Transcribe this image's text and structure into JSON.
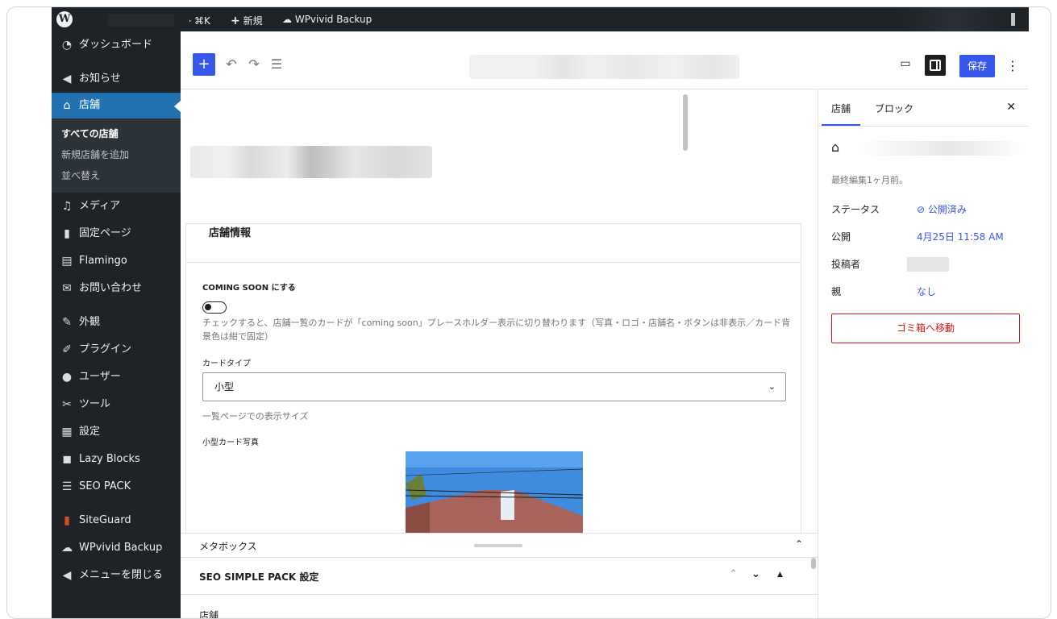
{
  "adminbar": {
    "wp_logo": "W",
    "shortcut": "⌘K",
    "new_label": "新規",
    "backup_label": "WPvivid Backup"
  },
  "sidebar": {
    "items": [
      {
        "label": "ダッシュボード",
        "icon": "dashboard-icon"
      },
      {
        "label": "お知らせ",
        "icon": "megaphone-icon"
      },
      {
        "label": "店舗",
        "icon": "store-icon"
      },
      {
        "label": "メディア",
        "icon": "media-icon"
      },
      {
        "label": "固定ページ",
        "icon": "page-icon"
      },
      {
        "label": "Flamingo",
        "icon": "flamingo-icon"
      },
      {
        "label": "お問い合わせ",
        "icon": "mail-icon"
      },
      {
        "label": "外観",
        "icon": "brush-icon"
      },
      {
        "label": "プラグイン",
        "icon": "plugin-icon"
      },
      {
        "label": "ユーザー",
        "icon": "user-icon"
      },
      {
        "label": "ツール",
        "icon": "wrench-icon"
      },
      {
        "label": "設定",
        "icon": "settings-icon"
      },
      {
        "label": "Lazy Blocks",
        "icon": "lazyblocks-icon"
      },
      {
        "label": "SEO PACK",
        "icon": "seo-icon"
      },
      {
        "label": "SiteGuard",
        "icon": "siteguard-icon"
      },
      {
        "label": "WPvivid Backup",
        "icon": "cloud-icon"
      },
      {
        "label": "メニューを閉じる",
        "icon": "collapse-icon"
      }
    ],
    "submenu": [
      "すべての店舗",
      "新規店舗を追加",
      "並べ替え"
    ]
  },
  "toolbar": {
    "save_label": "保存"
  },
  "store_info": {
    "heading": "店舗情報",
    "coming_soon_label": "COMING SOON にする",
    "coming_soon_help": "チェックすると、店舗一覧のカードが「coming soon」プレースホルダー表示に切り替わります（写真・ロゴ・店舗名・ボタンは非表示／カード背景色は紺で固定）",
    "card_type_label": "カードタイプ",
    "card_type_value": "小型",
    "card_type_help": "一覧ページでの表示サイズ",
    "small_photo_label": "小型カード写真"
  },
  "metabox": {
    "title": "メタボックス",
    "seo_title": "SEO SIMPLE PACK 設定",
    "store_label": "店舗"
  },
  "panel": {
    "tab_post": "店舗",
    "tab_block": "ブロック",
    "last_edited": "最終編集1ヶ月前。",
    "status_label": "ステータス",
    "status_value": "公開済み",
    "publish_label": "公開",
    "publish_value": "4月25日 11:58 AM",
    "author_label": "投稿者",
    "parent_label": "親",
    "parent_value": "なし",
    "trash_label": "ゴミ箱へ移動"
  },
  "colors": {
    "admin_dark": "#1d2327",
    "admin_blue": "#2271b1",
    "accent": "#3858e9",
    "danger": "#cc1818"
  }
}
